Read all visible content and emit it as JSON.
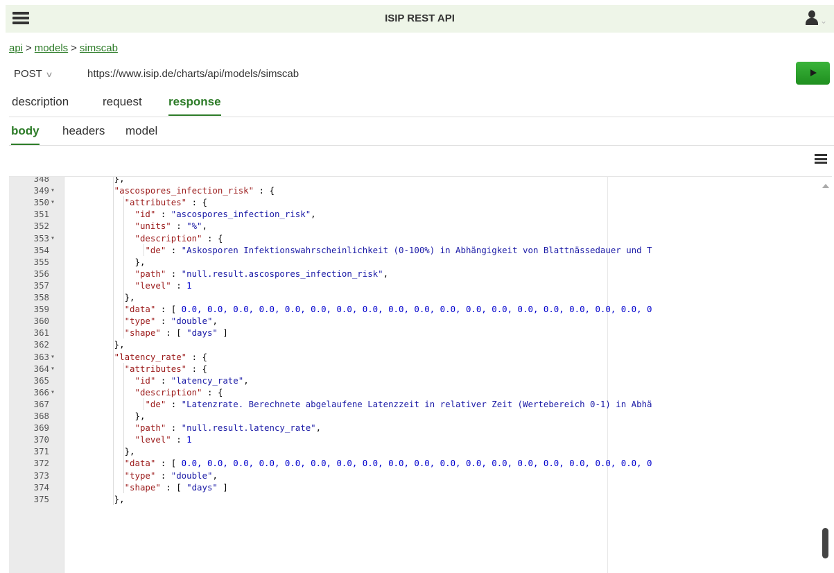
{
  "app": {
    "title": "ISIP REST API"
  },
  "breadcrumb": {
    "items": [
      "api",
      "models",
      "simscab"
    ],
    "separator": ">"
  },
  "request": {
    "method": "POST",
    "url": "https://www.isip.de/charts/api/models/simscab"
  },
  "tabs": {
    "description": "description",
    "request": "request",
    "response": "response"
  },
  "subtabs": {
    "body": "body",
    "headers": "headers",
    "model": "model"
  },
  "colors": {
    "accent": "#2c7b27",
    "run_button": "#2ea52e",
    "header_bg": "#eef5e8"
  },
  "icons": [
    "hamburger-menu-icon",
    "user-icon",
    "chevron-down-icon",
    "play-icon",
    "menu-icon"
  ],
  "editor": {
    "lines": [
      {
        "n": "348",
        "fold": false,
        "indent": 8,
        "parts": [
          [
            "p",
            "},"
          ]
        ]
      },
      {
        "n": "349",
        "fold": true,
        "indent": 8,
        "parts": [
          [
            "k",
            "\"ascospores_infection_risk\""
          ],
          [
            "p",
            " : {"
          ]
        ]
      },
      {
        "n": "350",
        "fold": true,
        "indent": 10,
        "parts": [
          [
            "k",
            "\"attributes\""
          ],
          [
            "p",
            " : {"
          ]
        ]
      },
      {
        "n": "351",
        "fold": false,
        "indent": 12,
        "parts": [
          [
            "k",
            "\"id\""
          ],
          [
            "p",
            " : "
          ],
          [
            "s",
            "\"ascospores_infection_risk\""
          ],
          [
            "p",
            ","
          ]
        ]
      },
      {
        "n": "352",
        "fold": false,
        "indent": 12,
        "parts": [
          [
            "k",
            "\"units\""
          ],
          [
            "p",
            " : "
          ],
          [
            "s",
            "\"%\""
          ],
          [
            "p",
            ","
          ]
        ]
      },
      {
        "n": "353",
        "fold": true,
        "indent": 12,
        "parts": [
          [
            "k",
            "\"description\""
          ],
          [
            "p",
            " : {"
          ]
        ]
      },
      {
        "n": "354",
        "fold": false,
        "indent": 14,
        "parts": [
          [
            "k",
            "\"de\""
          ],
          [
            "p",
            " : "
          ],
          [
            "s",
            "\"Askosporen Infektionswahrscheinlichkeit (0-100%) in Abhängigkeit von Blattnässedauer und T"
          ]
        ]
      },
      {
        "n": "355",
        "fold": false,
        "indent": 12,
        "parts": [
          [
            "p",
            "},"
          ]
        ]
      },
      {
        "n": "356",
        "fold": false,
        "indent": 12,
        "parts": [
          [
            "k",
            "\"path\""
          ],
          [
            "p",
            " : "
          ],
          [
            "s",
            "\"null.result.ascospores_infection_risk\""
          ],
          [
            "p",
            ","
          ]
        ]
      },
      {
        "n": "357",
        "fold": false,
        "indent": 12,
        "parts": [
          [
            "k",
            "\"level\""
          ],
          [
            "p",
            " : "
          ],
          [
            "n",
            "1"
          ]
        ]
      },
      {
        "n": "358",
        "fold": false,
        "indent": 10,
        "parts": [
          [
            "p",
            "},"
          ]
        ]
      },
      {
        "n": "359",
        "fold": false,
        "indent": 10,
        "parts": [
          [
            "k",
            "\"data\""
          ],
          [
            "p",
            " : [ "
          ],
          [
            "n",
            "0.0, 0.0, 0.0, 0.0, 0.0, 0.0, 0.0, 0.0, 0.0, 0.0, 0.0, 0.0, 0.0, 0.0, 0.0, 0.0, 0.0, 0.0, 0"
          ]
        ]
      },
      {
        "n": "360",
        "fold": false,
        "indent": 10,
        "parts": [
          [
            "k",
            "\"type\""
          ],
          [
            "p",
            " : "
          ],
          [
            "s",
            "\"double\""
          ],
          [
            "p",
            ","
          ]
        ]
      },
      {
        "n": "361",
        "fold": false,
        "indent": 10,
        "parts": [
          [
            "k",
            "\"shape\""
          ],
          [
            "p",
            " : [ "
          ],
          [
            "s",
            "\"days\""
          ],
          [
            "p",
            " ]"
          ]
        ]
      },
      {
        "n": "362",
        "fold": false,
        "indent": 8,
        "parts": [
          [
            "p",
            "},"
          ]
        ]
      },
      {
        "n": "363",
        "fold": true,
        "indent": 8,
        "parts": [
          [
            "k",
            "\"latency_rate\""
          ],
          [
            "p",
            " : {"
          ]
        ]
      },
      {
        "n": "364",
        "fold": true,
        "indent": 10,
        "parts": [
          [
            "k",
            "\"attributes\""
          ],
          [
            "p",
            " : {"
          ]
        ]
      },
      {
        "n": "365",
        "fold": false,
        "indent": 12,
        "parts": [
          [
            "k",
            "\"id\""
          ],
          [
            "p",
            " : "
          ],
          [
            "s",
            "\"latency_rate\""
          ],
          [
            "p",
            ","
          ]
        ]
      },
      {
        "n": "366",
        "fold": true,
        "indent": 12,
        "parts": [
          [
            "k",
            "\"description\""
          ],
          [
            "p",
            " : {"
          ]
        ]
      },
      {
        "n": "367",
        "fold": false,
        "indent": 14,
        "parts": [
          [
            "k",
            "\"de\""
          ],
          [
            "p",
            " : "
          ],
          [
            "s",
            "\"Latenzrate. Berechnete abgelaufene Latenzzeit in relativer Zeit (Wertebereich 0-1) in Abhä"
          ]
        ]
      },
      {
        "n": "368",
        "fold": false,
        "indent": 12,
        "parts": [
          [
            "p",
            "},"
          ]
        ]
      },
      {
        "n": "369",
        "fold": false,
        "indent": 12,
        "parts": [
          [
            "k",
            "\"path\""
          ],
          [
            "p",
            " : "
          ],
          [
            "s",
            "\"null.result.latency_rate\""
          ],
          [
            "p",
            ","
          ]
        ]
      },
      {
        "n": "370",
        "fold": false,
        "indent": 12,
        "parts": [
          [
            "k",
            "\"level\""
          ],
          [
            "p",
            " : "
          ],
          [
            "n",
            "1"
          ]
        ]
      },
      {
        "n": "371",
        "fold": false,
        "indent": 10,
        "parts": [
          [
            "p",
            "},"
          ]
        ]
      },
      {
        "n": "372",
        "fold": false,
        "indent": 10,
        "parts": [
          [
            "k",
            "\"data\""
          ],
          [
            "p",
            " : [ "
          ],
          [
            "n",
            "0.0, 0.0, 0.0, 0.0, 0.0, 0.0, 0.0, 0.0, 0.0, 0.0, 0.0, 0.0, 0.0, 0.0, 0.0, 0.0, 0.0, 0.0, 0"
          ]
        ]
      },
      {
        "n": "373",
        "fold": false,
        "indent": 10,
        "parts": [
          [
            "k",
            "\"type\""
          ],
          [
            "p",
            " : "
          ],
          [
            "s",
            "\"double\""
          ],
          [
            "p",
            ","
          ]
        ]
      },
      {
        "n": "374",
        "fold": false,
        "indent": 10,
        "parts": [
          [
            "k",
            "\"shape\""
          ],
          [
            "p",
            " : [ "
          ],
          [
            "s",
            "\"days\""
          ],
          [
            "p",
            " ]"
          ]
        ]
      },
      {
        "n": "375",
        "fold": false,
        "indent": 8,
        "parts": [
          [
            "p",
            "},"
          ]
        ]
      }
    ]
  }
}
